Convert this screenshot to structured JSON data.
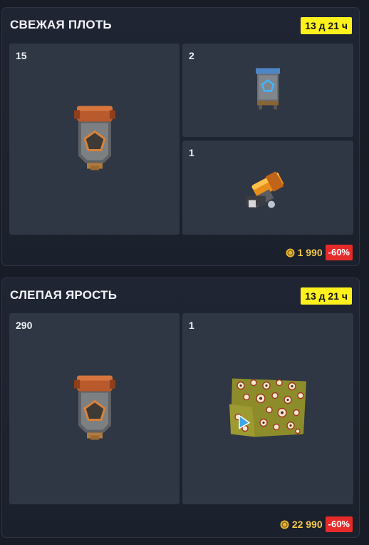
{
  "offers": [
    {
      "title": "СВЕЖАЯ ПЛОТЬ",
      "timer": "13 д 21 ч",
      "items": [
        {
          "count": "15",
          "icon": "reinforced-container-icon"
        },
        {
          "count": "2",
          "icon": "blue-crate-icon"
        },
        {
          "count": "1",
          "icon": "rocket-launcher-weapon-icon"
        }
      ],
      "price": "1 990",
      "discount": "-60%"
    },
    {
      "title": "СЛЕПАЯ ЯРОСТЬ",
      "timer": "13 д 21 ч",
      "items": [
        {
          "count": "290",
          "icon": "reinforced-container-icon"
        },
        {
          "count": "1",
          "icon": "eyes-camo-paint-icon"
        }
      ],
      "price": "22 990",
      "discount": "-60%"
    }
  ],
  "colors": {
    "timer_bg": "#fff21c",
    "price_gold": "#f3c94a",
    "discount_red": "#e52a2a",
    "tile_bg": "#2f3644"
  }
}
